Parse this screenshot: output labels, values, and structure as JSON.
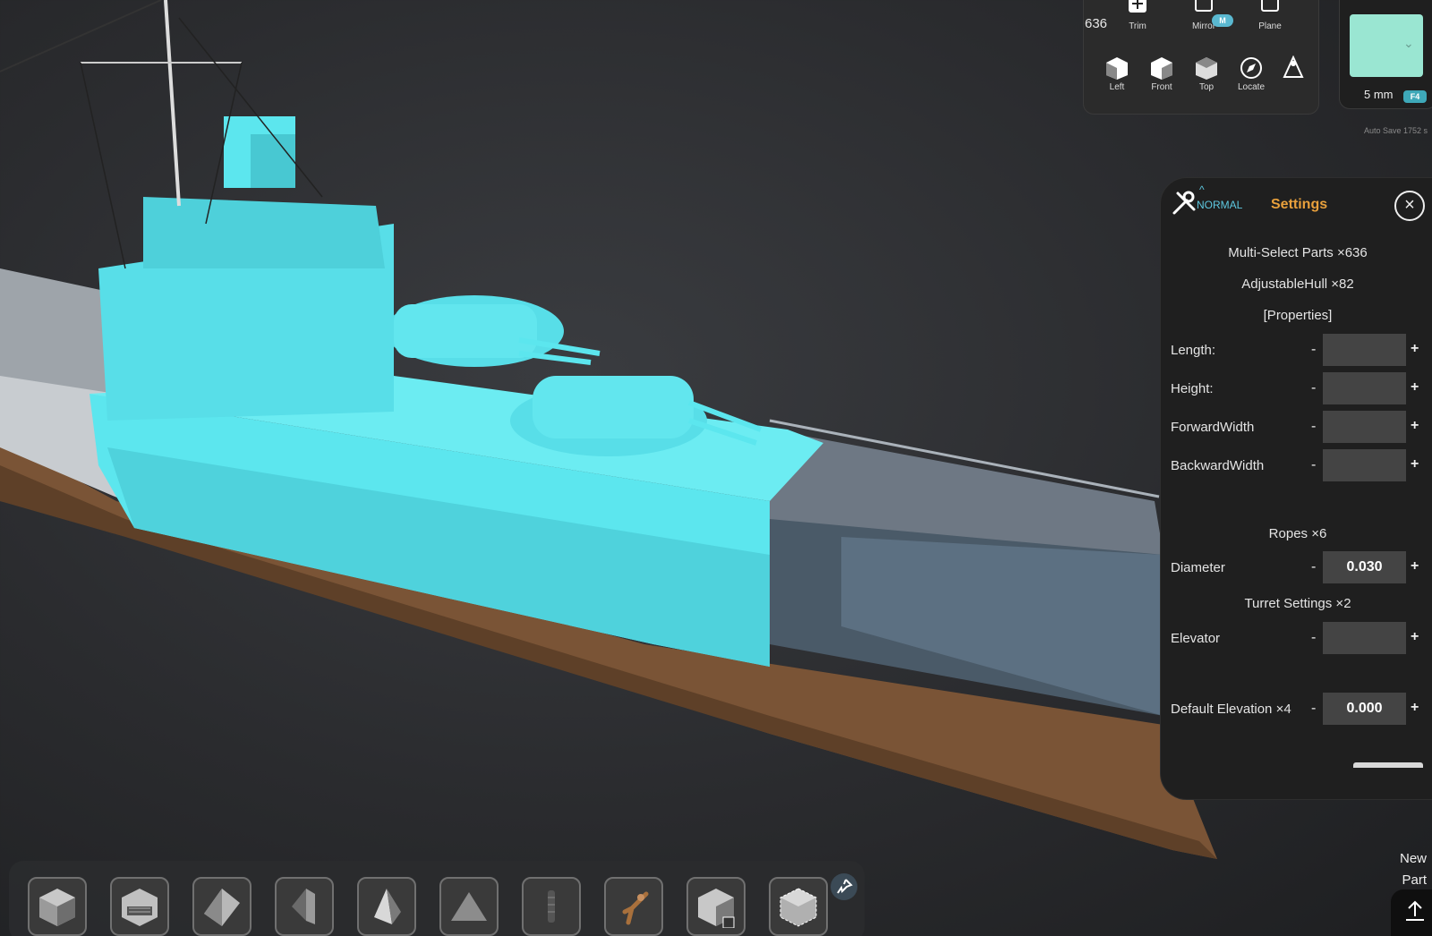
{
  "toolbar": {
    "part_count": "636",
    "tools_row1": [
      {
        "label": "Trim",
        "icon": "scale-icon"
      },
      {
        "label": "Mirror",
        "icon": "mirror-icon"
      },
      {
        "label": "Plane",
        "icon": "plane-icon"
      }
    ],
    "mirror_badge": "M",
    "tools_row2": [
      {
        "label": "Left",
        "icon": "cube-left-icon"
      },
      {
        "label": "Front",
        "icon": "cube-front-icon"
      },
      {
        "label": "Top",
        "icon": "cube-top-icon"
      },
      {
        "label": "Locate",
        "icon": "compass-icon"
      },
      {
        "label": "",
        "icon": "measure-icon"
      }
    ]
  },
  "swatch": {
    "color": "#9ae6d2",
    "grid_size": "5 mm",
    "hotkey": "F4",
    "autosave": "Auto Save 1752 s"
  },
  "settings": {
    "mode": "NORMAL",
    "title": "Settings",
    "multi_select": "Multi-Select Parts ×636",
    "hull_group": "AdjustableHull ×82",
    "properties_header": "[Properties]",
    "hull_props": [
      {
        "label": "Length:",
        "value": ""
      },
      {
        "label": "Height:",
        "value": ""
      },
      {
        "label": "ForwardWidth",
        "value": ""
      },
      {
        "label": "BackwardWidth",
        "value": ""
      }
    ],
    "ropes_group": "Ropes ×6",
    "diameter_label": "Diameter",
    "diameter_value": "0.030",
    "turret_group": "Turret Settings ×2",
    "elevator_label": "Elevator",
    "elevator_value": "",
    "default_elev_label": "Default Elevation ×4",
    "default_elev_value": "0.000",
    "minus": "-",
    "plus": "+"
  },
  "palette": {
    "shapes": [
      "cube-icon",
      "cabin-icon",
      "wedge-icon",
      "half-wedge-icon",
      "pyramid-icon",
      "prism-icon",
      "cylinder-icon",
      "figure-icon",
      "custom-cube-icon",
      "wire-cube-icon"
    ]
  },
  "new_part": {
    "line1": "New",
    "line2": "Part"
  },
  "colors": {
    "selection": "#5ce6ee",
    "accent": "#e8a03c",
    "mode": "#5ec8e0"
  }
}
